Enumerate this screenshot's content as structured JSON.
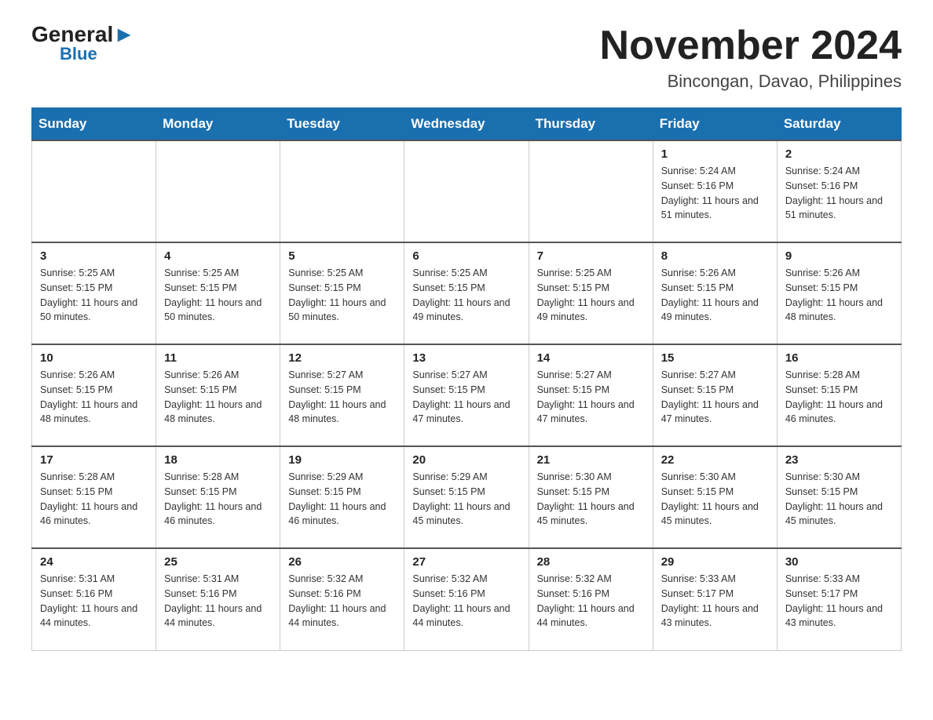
{
  "logo": {
    "general": "General",
    "triangle": "▶",
    "blue": "Blue"
  },
  "title": "November 2024",
  "subtitle": "Bincongan, Davao, Philippines",
  "weekdays": [
    "Sunday",
    "Monday",
    "Tuesday",
    "Wednesday",
    "Thursday",
    "Friday",
    "Saturday"
  ],
  "weeks": [
    [
      {
        "day": "",
        "info": ""
      },
      {
        "day": "",
        "info": ""
      },
      {
        "day": "",
        "info": ""
      },
      {
        "day": "",
        "info": ""
      },
      {
        "day": "",
        "info": ""
      },
      {
        "day": "1",
        "info": "Sunrise: 5:24 AM\nSunset: 5:16 PM\nDaylight: 11 hours and 51 minutes."
      },
      {
        "day": "2",
        "info": "Sunrise: 5:24 AM\nSunset: 5:16 PM\nDaylight: 11 hours and 51 minutes."
      }
    ],
    [
      {
        "day": "3",
        "info": "Sunrise: 5:25 AM\nSunset: 5:15 PM\nDaylight: 11 hours and 50 minutes."
      },
      {
        "day": "4",
        "info": "Sunrise: 5:25 AM\nSunset: 5:15 PM\nDaylight: 11 hours and 50 minutes."
      },
      {
        "day": "5",
        "info": "Sunrise: 5:25 AM\nSunset: 5:15 PM\nDaylight: 11 hours and 50 minutes."
      },
      {
        "day": "6",
        "info": "Sunrise: 5:25 AM\nSunset: 5:15 PM\nDaylight: 11 hours and 49 minutes."
      },
      {
        "day": "7",
        "info": "Sunrise: 5:25 AM\nSunset: 5:15 PM\nDaylight: 11 hours and 49 minutes."
      },
      {
        "day": "8",
        "info": "Sunrise: 5:26 AM\nSunset: 5:15 PM\nDaylight: 11 hours and 49 minutes."
      },
      {
        "day": "9",
        "info": "Sunrise: 5:26 AM\nSunset: 5:15 PM\nDaylight: 11 hours and 48 minutes."
      }
    ],
    [
      {
        "day": "10",
        "info": "Sunrise: 5:26 AM\nSunset: 5:15 PM\nDaylight: 11 hours and 48 minutes."
      },
      {
        "day": "11",
        "info": "Sunrise: 5:26 AM\nSunset: 5:15 PM\nDaylight: 11 hours and 48 minutes."
      },
      {
        "day": "12",
        "info": "Sunrise: 5:27 AM\nSunset: 5:15 PM\nDaylight: 11 hours and 48 minutes."
      },
      {
        "day": "13",
        "info": "Sunrise: 5:27 AM\nSunset: 5:15 PM\nDaylight: 11 hours and 47 minutes."
      },
      {
        "day": "14",
        "info": "Sunrise: 5:27 AM\nSunset: 5:15 PM\nDaylight: 11 hours and 47 minutes."
      },
      {
        "day": "15",
        "info": "Sunrise: 5:27 AM\nSunset: 5:15 PM\nDaylight: 11 hours and 47 minutes."
      },
      {
        "day": "16",
        "info": "Sunrise: 5:28 AM\nSunset: 5:15 PM\nDaylight: 11 hours and 46 minutes."
      }
    ],
    [
      {
        "day": "17",
        "info": "Sunrise: 5:28 AM\nSunset: 5:15 PM\nDaylight: 11 hours and 46 minutes."
      },
      {
        "day": "18",
        "info": "Sunrise: 5:28 AM\nSunset: 5:15 PM\nDaylight: 11 hours and 46 minutes."
      },
      {
        "day": "19",
        "info": "Sunrise: 5:29 AM\nSunset: 5:15 PM\nDaylight: 11 hours and 46 minutes."
      },
      {
        "day": "20",
        "info": "Sunrise: 5:29 AM\nSunset: 5:15 PM\nDaylight: 11 hours and 45 minutes."
      },
      {
        "day": "21",
        "info": "Sunrise: 5:30 AM\nSunset: 5:15 PM\nDaylight: 11 hours and 45 minutes."
      },
      {
        "day": "22",
        "info": "Sunrise: 5:30 AM\nSunset: 5:15 PM\nDaylight: 11 hours and 45 minutes."
      },
      {
        "day": "23",
        "info": "Sunrise: 5:30 AM\nSunset: 5:15 PM\nDaylight: 11 hours and 45 minutes."
      }
    ],
    [
      {
        "day": "24",
        "info": "Sunrise: 5:31 AM\nSunset: 5:16 PM\nDaylight: 11 hours and 44 minutes."
      },
      {
        "day": "25",
        "info": "Sunrise: 5:31 AM\nSunset: 5:16 PM\nDaylight: 11 hours and 44 minutes."
      },
      {
        "day": "26",
        "info": "Sunrise: 5:32 AM\nSunset: 5:16 PM\nDaylight: 11 hours and 44 minutes."
      },
      {
        "day": "27",
        "info": "Sunrise: 5:32 AM\nSunset: 5:16 PM\nDaylight: 11 hours and 44 minutes."
      },
      {
        "day": "28",
        "info": "Sunrise: 5:32 AM\nSunset: 5:16 PM\nDaylight: 11 hours and 44 minutes."
      },
      {
        "day": "29",
        "info": "Sunrise: 5:33 AM\nSunset: 5:17 PM\nDaylight: 11 hours and 43 minutes."
      },
      {
        "day": "30",
        "info": "Sunrise: 5:33 AM\nSunset: 5:17 PM\nDaylight: 11 hours and 43 minutes."
      }
    ]
  ]
}
